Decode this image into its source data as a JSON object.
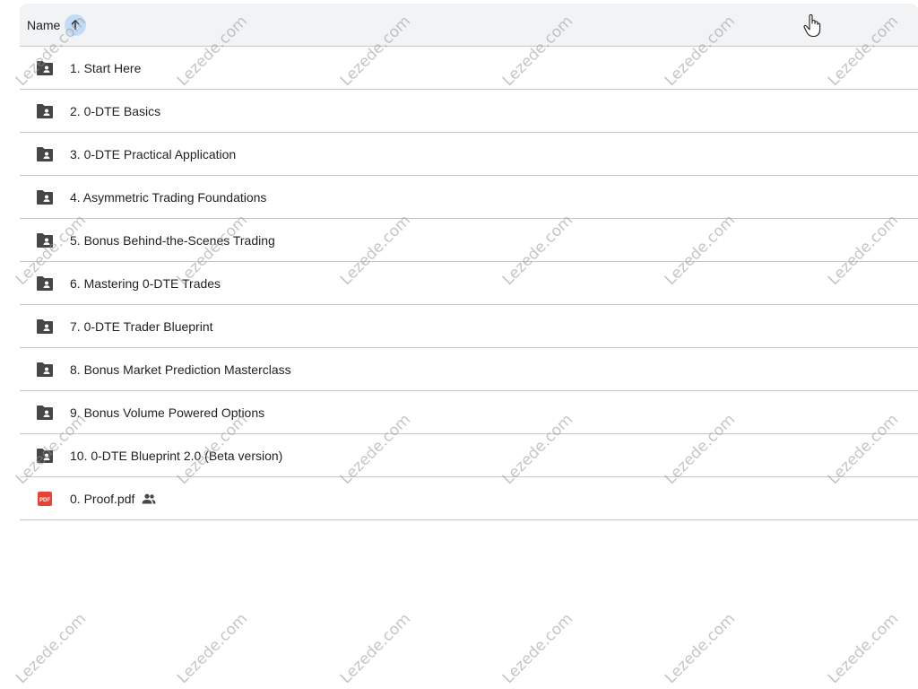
{
  "header": {
    "name_label": "Name"
  },
  "items": [
    {
      "label": "1. Start Here",
      "type": "shared-folder"
    },
    {
      "label": "2. 0-DTE Basics",
      "type": "shared-folder"
    },
    {
      "label": "3. 0-DTE Practical Application",
      "type": "shared-folder"
    },
    {
      "label": "4. Asymmetric Trading Foundations",
      "type": "shared-folder"
    },
    {
      "label": "5. Bonus Behind-the-Scenes Trading",
      "type": "shared-folder"
    },
    {
      "label": "6. Mastering 0-DTE Trades",
      "type": "shared-folder"
    },
    {
      "label": "7. 0-DTE Trader Blueprint",
      "type": "shared-folder"
    },
    {
      "label": "8. Bonus Market Prediction Masterclass",
      "type": "shared-folder"
    },
    {
      "label": "9. Bonus Volume Powered Options",
      "type": "shared-folder"
    },
    {
      "label": "10. 0-DTE Blueprint 2.0 (Beta version)",
      "type": "shared-folder"
    },
    {
      "label": "0. Proof.pdf",
      "type": "pdf",
      "shared": true,
      "pdf_badge": "PDF"
    }
  ],
  "watermark": "Lezede.com",
  "colors": {
    "folder": "#444746",
    "pdf": "#ea4335",
    "header_bg": "#f1f3f4",
    "sort_highlight": "#c2dbf7"
  }
}
